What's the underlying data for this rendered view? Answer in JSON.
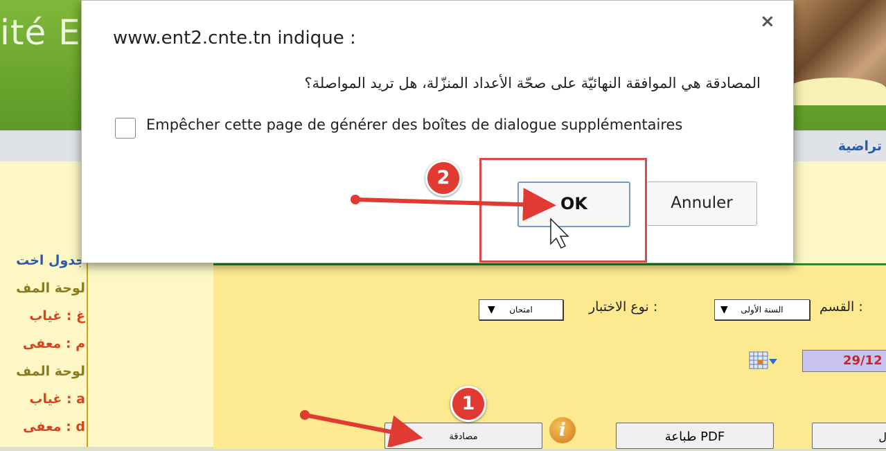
{
  "background": {
    "banner_title": "ité E",
    "nav_link": "تراضية",
    "side_items": [
      {
        "label": "جدول اخت",
        "color": "#2a5aa8"
      },
      {
        "label": "لوحة المف",
        "color": "#8a7a20"
      },
      {
        "label": "غ : غياب",
        "color": "#d8431f"
      },
      {
        "label": "م : معفى",
        "color": "#d8431f"
      },
      {
        "label": "لوحة المف",
        "color": "#8a7a20"
      },
      {
        "label": "a : غياب",
        "color": "#d8431f"
      },
      {
        "label": "d : معفى",
        "color": "#d8431f"
      }
    ],
    "section_label": "القسم :",
    "section_value": "السنة الأولى",
    "test_type_label": "نوع الاختبار :",
    "test_type_value": "امتحان",
    "date_value": "29/12",
    "validate_button": "مصادقة",
    "pdf_button": "طباعة PDF",
    "right_button": "ل"
  },
  "dialog": {
    "title": "www.ent2.cnte.tn indique :",
    "message": "المصادقة هي الموافقة النهائيّة على صحّة الأعداد المنزّلة،  هل تريد المواصلة؟",
    "checkbox_label": "Empêcher cette page de générer des boîtes de dialogue supplémentaires",
    "ok_label": "OK",
    "cancel_label": "Annuler",
    "close_symbol": "×"
  },
  "annotations": {
    "step1": "1",
    "step2": "2",
    "color": "#e03a32"
  }
}
